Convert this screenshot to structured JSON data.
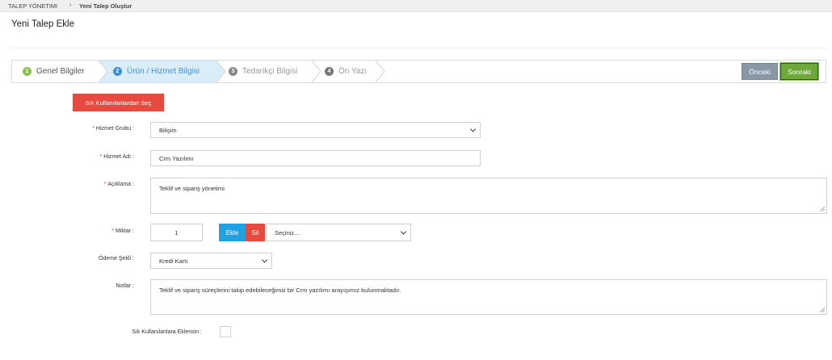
{
  "breadcrumb": {
    "root": "TALEP YÖNETIMI",
    "separator": "›",
    "current": "Yeni Talep Oluştur"
  },
  "page": {
    "title": "Yeni Talep Ekle"
  },
  "wizard": {
    "steps": [
      {
        "number": "1",
        "label": "Genel Bilgiler",
        "state": "done"
      },
      {
        "number": "2",
        "label": "Ürün / Hizmet Bilgisi",
        "state": "active"
      },
      {
        "number": "3",
        "label": "Tedarikçi Bilgisi",
        "state": "pending"
      },
      {
        "number": "4",
        "label": "Ön Yazı",
        "state": "pending"
      }
    ],
    "prev_label": "Önceki",
    "next_label": "Sonraki"
  },
  "form": {
    "favorites_button": "Sık Kullanılanlardan Seç",
    "required_mark": "*",
    "service_group": {
      "label": "Hizmet Grubu :",
      "value": "Bilişim"
    },
    "service_name": {
      "label": "Hizmet Adı :",
      "value": "Crm Yazılımı"
    },
    "description": {
      "label": "Açıklama :",
      "value": "Teklif ve sipariş yönetimi"
    },
    "quantity": {
      "label": "Miktar :",
      "value": "1",
      "add_label": "Ekle",
      "delete_label": "Sil",
      "unit_placeholder": "Seçiniz..."
    },
    "payment": {
      "label": "Ödeme Şekli :",
      "value": "Kredi Kartı"
    },
    "notes": {
      "label": "Notlar :",
      "value": "Teklif ve sipariş süreçlerini takip edebileceğimiz bir Crm yazılımı arayışımız bulunmaktadır."
    },
    "add_to_favorites": {
      "label": "Sık Kullanılanlara Eklensin :",
      "checked": false
    }
  },
  "colors": {
    "active_step_bg": "#daeefa",
    "primary_red": "#e84a3f",
    "add_blue": "#1fa2e4",
    "next_green": "#6ea83b",
    "prev_gray": "#8898a6"
  }
}
